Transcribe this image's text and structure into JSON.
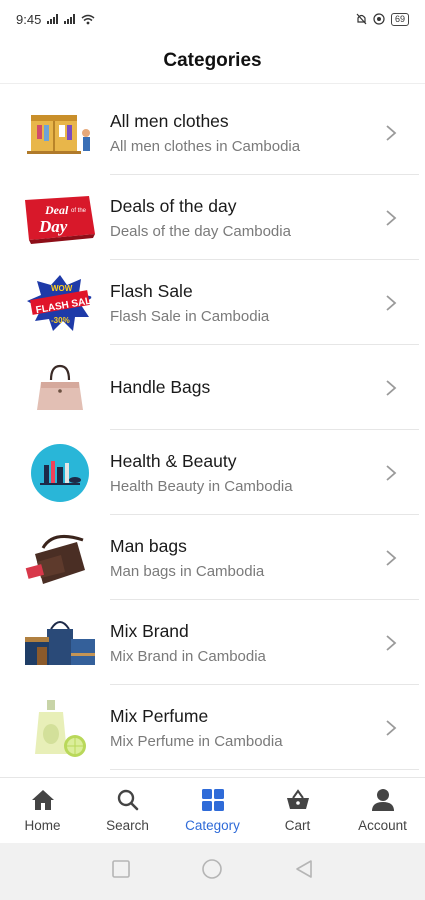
{
  "status_bar": {
    "time": "9:45",
    "right_text": "69"
  },
  "header": {
    "title": "Categories"
  },
  "categories": [
    {
      "title": "All men clothes",
      "subtitle": "All men clothes in Cambodia",
      "icon": "wardrobe-thumbnail"
    },
    {
      "title": "Deals of the day",
      "subtitle": "Deals of the day Cambodia",
      "icon": "deal-of-the-day-thumbnail",
      "thumb_text": [
        "Deal",
        "of the",
        "Day"
      ]
    },
    {
      "title": "Flash Sale",
      "subtitle": "Flash Sale in Cambodia",
      "icon": "flash-sale-thumbnail",
      "thumb_text": [
        "WOW",
        "FLASH SALE",
        "-30%"
      ]
    },
    {
      "title": "Handle Bags",
      "subtitle": "",
      "icon": "handbag-thumbnail"
    },
    {
      "title": "Health & Beauty",
      "subtitle": "Health Beauty in Cambodia",
      "icon": "cosmetics-thumbnail"
    },
    {
      "title": "Man bags",
      "subtitle": "Man bags in Cambodia",
      "icon": "man-bag-thumbnail"
    },
    {
      "title": "Mix Brand",
      "subtitle": "Mix Brand in Cambodia",
      "icon": "mix-brand-bags-thumbnail"
    },
    {
      "title": "Mix Perfume",
      "subtitle": "Mix Perfume in Cambodia",
      "icon": "perfume-thumbnail"
    }
  ],
  "bottom_nav": {
    "items": [
      {
        "label": "Home",
        "icon": "home-icon"
      },
      {
        "label": "Search",
        "icon": "search-icon"
      },
      {
        "label": "Category",
        "icon": "grid-icon",
        "active": true
      },
      {
        "label": "Cart",
        "icon": "basket-icon"
      },
      {
        "label": "Account",
        "icon": "person-icon"
      }
    ]
  },
  "colors": {
    "accent": "#2f6bd8",
    "divider": "#e6e6e6",
    "subtitle": "#7a7a7a"
  }
}
